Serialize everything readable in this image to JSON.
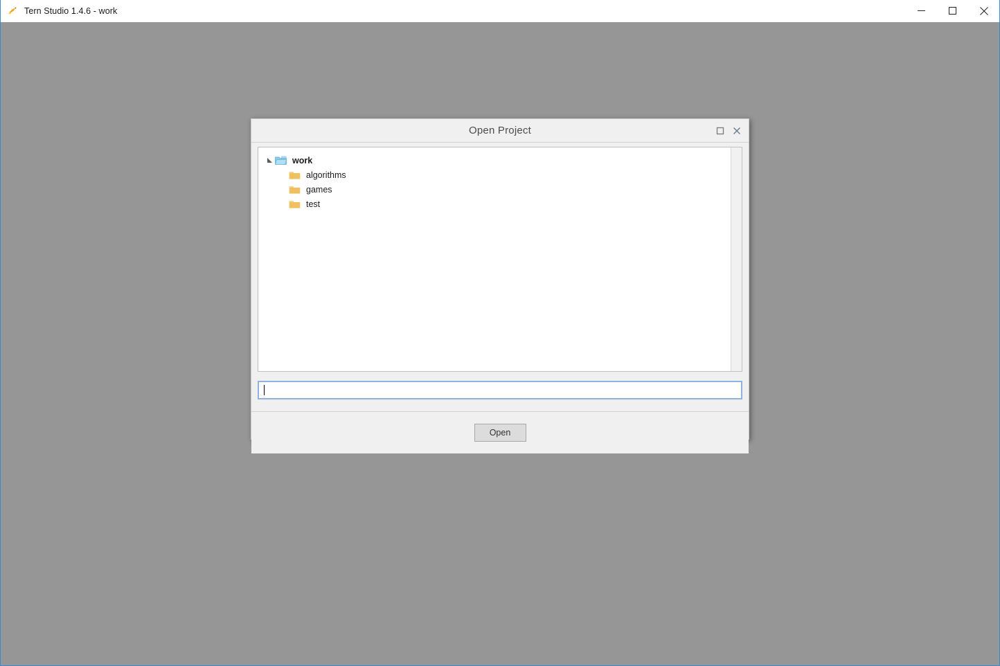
{
  "app": {
    "title": "Tern Studio 1.4.6 - work",
    "icon": "tern-bird-icon",
    "window_controls": [
      {
        "name": "minimize-button",
        "glyph": "minimize"
      },
      {
        "name": "maximize-button",
        "glyph": "maximize"
      },
      {
        "name": "close-button",
        "glyph": "close"
      }
    ]
  },
  "dialog": {
    "title": "Open Project",
    "window_controls": [
      {
        "name": "dialog-maximize-button",
        "glyph": "maximize"
      },
      {
        "name": "dialog-close-button",
        "glyph": "close"
      }
    ],
    "tree": {
      "root": {
        "label": "work",
        "icon": "open-folder-icon",
        "expanded": true,
        "arrow": "expanded-triangle-icon"
      },
      "children": [
        {
          "label": "algorithms",
          "icon": "folder-icon"
        },
        {
          "label": "games",
          "icon": "folder-icon"
        },
        {
          "label": "test",
          "icon": "folder-icon"
        }
      ]
    },
    "path_input": {
      "value": "",
      "placeholder": "",
      "focused": true
    },
    "buttons": {
      "open_label": "Open"
    }
  },
  "colors": {
    "window_border": "#3a8ad1",
    "desktop_background": "#969696",
    "dialog_background": "#f0f0f0",
    "tree_background": "#ffffff",
    "folder_orange": "#f0c060",
    "folder_blue": "#8ccdee",
    "input_focus_border": "#8fb2e0",
    "button_face": "#dcdcdc"
  }
}
